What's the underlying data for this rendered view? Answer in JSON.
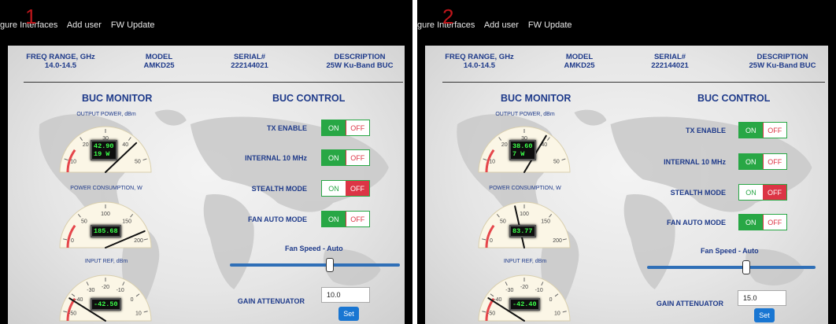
{
  "nav": {
    "links": [
      "gure Interfaces",
      "Add user",
      "FW Update"
    ]
  },
  "header": {
    "freq": {
      "label": "FREQ RANGE, GHz",
      "value": "14.0-14.5"
    },
    "model": {
      "label": "MODEL",
      "value": "AMKD25"
    },
    "serial": {
      "label": "SERIAL#",
      "value": "222144021"
    },
    "description": {
      "label": "DESCRIPTION",
      "value": "25W Ku-Band BUC"
    }
  },
  "monitor": {
    "title": "BUC MONITOR",
    "output_power_label": "OUTPUT POWER, dBm",
    "power_consumption_label": "POWER CONSUMPTION, W",
    "input_ref_label": "INPUT REF, dBm",
    "output_ticks": [
      "10",
      "20",
      "30",
      "40",
      "50"
    ],
    "consumption_ticks": [
      "0",
      "50",
      "100",
      "150",
      "200"
    ],
    "input_ticks": [
      "-50",
      "-40",
      "-30",
      "-20",
      "-10",
      "0",
      "10"
    ]
  },
  "control": {
    "title": "BUC CONTROL",
    "tx_enable": "TX ENABLE",
    "internal_10mhz": "INTERNAL 10 MHz",
    "stealth_mode": "STEALTH MODE",
    "fan_auto_mode": "FAN AUTO MODE",
    "on": "ON",
    "off": "OFF",
    "fan_speed": "Fan Speed - Auto",
    "gain_attenuator": "GAIN ATTENUATOR",
    "set": "Set"
  },
  "panels": [
    {
      "label": "1",
      "output_power_lcd": "42.90\n19 W",
      "output_power_dbm": 42.9,
      "power_consumption_lcd": "185.68",
      "power_consumption_w": 185.68,
      "input_ref_lcd": "-42.50",
      "input_ref_dbm": -42.5,
      "tx_enable": "on",
      "internal_10mhz": "on",
      "stealth_mode": "off",
      "fan_auto_mode": "on",
      "fan_speed_fraction": 0.59,
      "gain_attenuator_value": "10.0"
    },
    {
      "label": "2",
      "output_power_lcd": "38.60\n7 W",
      "output_power_dbm": 38.6,
      "power_consumption_lcd": "83.77",
      "power_consumption_w": 83.77,
      "input_ref_lcd": "-42.40",
      "input_ref_dbm": -42.4,
      "tx_enable": "on",
      "internal_10mhz": "on",
      "stealth_mode": "off",
      "fan_auto_mode": "on",
      "fan_speed_fraction": 0.59,
      "gain_attenuator_value": "15.0"
    }
  ],
  "colors": {
    "navy": "#1e3a8a",
    "on_green": "#28a745",
    "off_red": "#dc3545",
    "lcd_green": "#3cff4a",
    "slider_blue": "#2f6fb7",
    "set_blue": "#1976d2",
    "label_red": "#c0161b"
  }
}
